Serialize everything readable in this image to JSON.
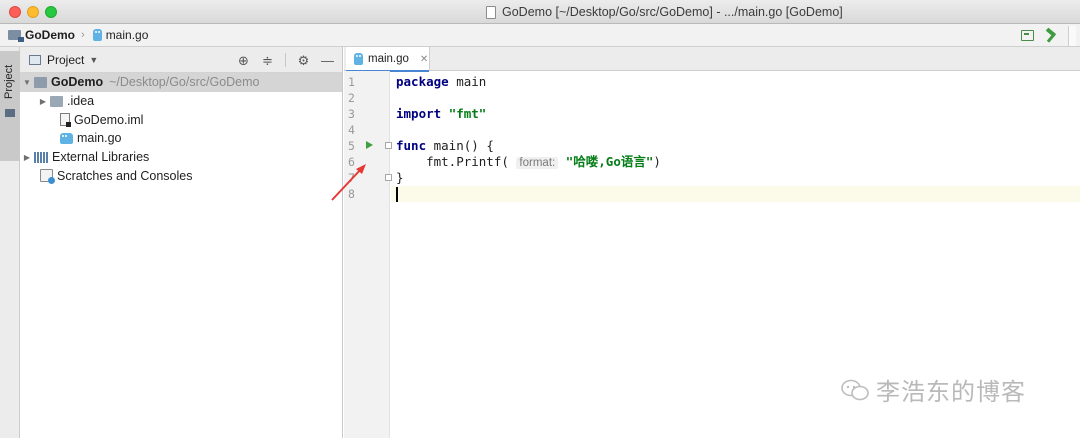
{
  "window": {
    "title": "GoDemo [~/Desktop/Go/src/GoDemo] - .../main.go [GoDemo]"
  },
  "navbar": {
    "project": "GoDemo",
    "file": "main.go"
  },
  "sidebar": {
    "tab_label": "Project"
  },
  "project_panel": {
    "title": "Project",
    "tree": [
      {
        "label": "GoDemo",
        "path": "~/Desktop/Go/src/GoDemo"
      },
      {
        "label": ".idea"
      },
      {
        "label": "GoDemo.iml"
      },
      {
        "label": "main.go"
      },
      {
        "label": "External Libraries"
      },
      {
        "label": "Scratches and Consoles"
      }
    ]
  },
  "editor": {
    "tab_label": "main.go",
    "line_numbers": [
      "1",
      "2",
      "3",
      "4",
      "5",
      "6",
      "7",
      "8"
    ],
    "code": {
      "l1_kw": "package",
      "l1_rest": " main",
      "l3_kw": "import",
      "l3_str": "\"fmt\"",
      "l5_kw": "func",
      "l5_rest": " main() {",
      "l6_pre": "    fmt.Printf(",
      "l6_hint": "format:",
      "l6_str": "\"哈喽,Go语言\"",
      "l6_post": ")",
      "l7": "}"
    }
  },
  "watermark": {
    "text": "李浩东的博客"
  },
  "colors": {
    "keyword": "#000080",
    "string": "#067d17",
    "selection": "#d5d5d5",
    "current_line": "#fcfae8",
    "run_icon": "#3ea03e",
    "annotation_arrow": "#e53935"
  }
}
